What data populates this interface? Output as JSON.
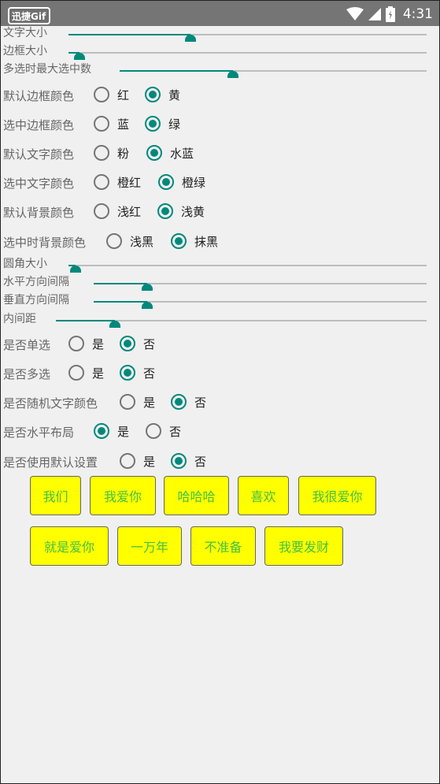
{
  "status_bar": {
    "app_badge": "迅捷Gif",
    "time": "4:31",
    "icons": [
      "wifi-icon",
      "signal-icon",
      "battery-icon"
    ]
  },
  "sliders": [
    {
      "label": "文字大小",
      "value": 0.34
    },
    {
      "label": "边框大小",
      "value": 0.03
    },
    {
      "label": "多选时最大选中数",
      "value": 0.37
    },
    {
      "label": "圆角大小",
      "value": 0.02
    },
    {
      "label": "水平方向间隔",
      "value": 0.16
    },
    {
      "label": "垂直方向间隔",
      "value": 0.16
    },
    {
      "label": "内间距",
      "value": 0.16
    }
  ],
  "radio_groups": [
    {
      "label": "默认边框颜色",
      "options": [
        "红",
        "黄"
      ],
      "selected": 1
    },
    {
      "label": "选中边框颜色",
      "options": [
        "蓝",
        "绿"
      ],
      "selected": 1
    },
    {
      "label": "默认文字颜色",
      "options": [
        "粉",
        "水蓝"
      ],
      "selected": 1
    },
    {
      "label": "选中文字颜色",
      "options": [
        "橙红",
        "橙绿"
      ],
      "selected": 1
    },
    {
      "label": "默认背景颜色",
      "options": [
        "浅红",
        "浅黄"
      ],
      "selected": 1
    },
    {
      "label": "选中时背景颜色",
      "options": [
        "浅黑",
        "抹黑"
      ],
      "selected": 1
    },
    {
      "label": "是否单选",
      "options": [
        "是",
        "否"
      ],
      "selected": 1
    },
    {
      "label": "是否多选",
      "options": [
        "是",
        "否"
      ],
      "selected": 1
    },
    {
      "label": "是否随机文字颜色",
      "options": [
        "是",
        "否"
      ],
      "selected": 1
    },
    {
      "label": "是否水平布局",
      "options": [
        "是",
        "否"
      ],
      "selected": 0
    },
    {
      "label": "是否使用默认设置",
      "options": [
        "是",
        "否"
      ],
      "selected": 1
    }
  ],
  "tags": [
    [
      "我们",
      "我爱你",
      "哈哈哈",
      "喜欢",
      "我很爱你"
    ],
    [
      "就是爱你",
      "一万年",
      "不准备",
      "我要发财"
    ]
  ],
  "colors": {
    "accent": "#00897b",
    "tag_bg": "#ffff00",
    "tag_text": "#44c044",
    "status_bar": "#757575"
  }
}
